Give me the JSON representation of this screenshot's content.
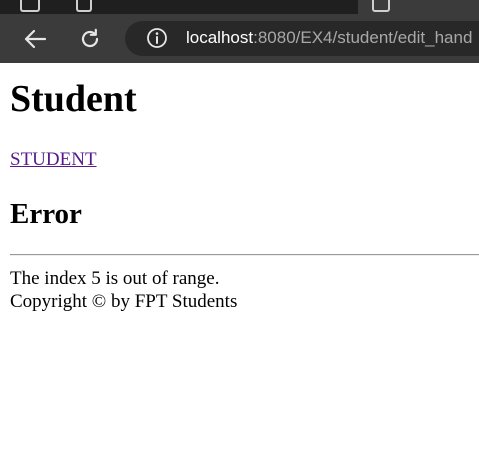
{
  "browser": {
    "url_host": "localhost",
    "url_rest": ":8080/EX4/student/edit_hand",
    "icons": {
      "back": "back-arrow-icon",
      "reload": "reload-icon",
      "site_info": "info-icon"
    },
    "colors": {
      "toolbar_bg": "#3b3b3b",
      "omnibox_bg": "#282828",
      "url_host": "#ffffff",
      "url_rest": "#a8a8a8"
    }
  },
  "page": {
    "title": "Student",
    "nav_link": "STUDENT",
    "error_heading": "Error",
    "error_message": "The index 5 is out of range.",
    "footer": "Copyright © by FPT Students",
    "colors": {
      "link": "#551a8b",
      "text": "#000000"
    }
  }
}
